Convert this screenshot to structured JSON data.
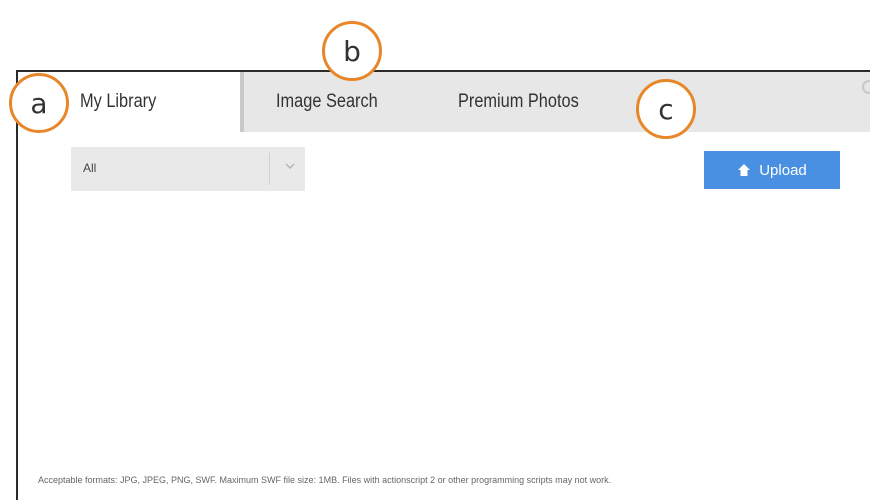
{
  "tabs": {
    "my_library": "My Library",
    "image_search": "Image Search",
    "premium_photos": "Premium Photos"
  },
  "filter": {
    "value": "All"
  },
  "upload": {
    "label": "Upload",
    "color": "#4a90e2"
  },
  "footer": {
    "note": "Acceptable formats: JPG, JPEG, PNG, SWF. Maximum SWF file size: 1MB. Files with actionscript 2 or other programming scripts may not work."
  },
  "callouts": {
    "a": "a",
    "b": "b",
    "c": "c",
    "color": "#e8862a"
  },
  "icons": {
    "upload": "upload-home-icon",
    "chevron": "chevron-down-icon",
    "close": "close-icon"
  }
}
